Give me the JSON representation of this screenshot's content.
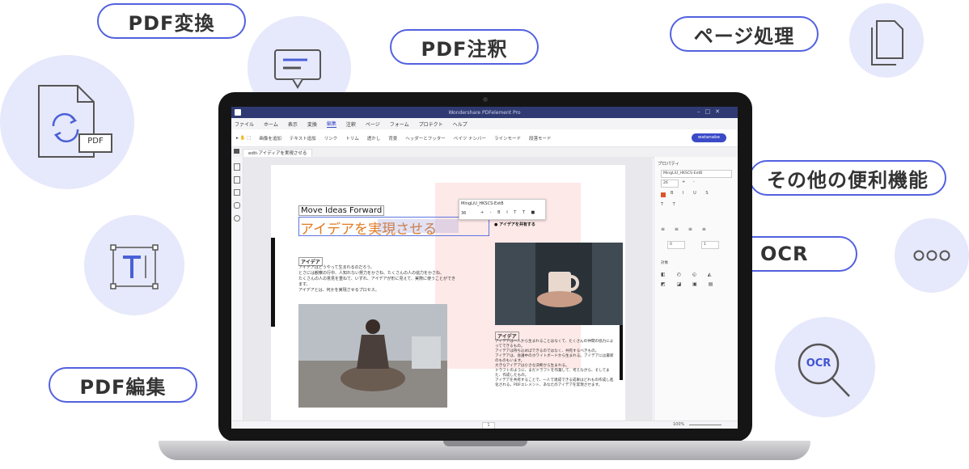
{
  "features": {
    "pdf_convert": "PDF変換",
    "pdf_annotate": "PDF注釈",
    "page_process": "ページ処理",
    "other_features": "その他の便利機能",
    "ocr": "OCR",
    "pdf_edit": "PDF編集",
    "ocr_icon_text": "OCR",
    "pdf_file_label": "PDF"
  },
  "app": {
    "title": "Wondershare PDFelement Pro",
    "menu": [
      "ファイル",
      "ホーム",
      "表示",
      "変換",
      "編集",
      "注釈",
      "ページ",
      "フォーム",
      "プロテクト",
      "ヘルプ"
    ],
    "active_menu_index": 4,
    "toolbar": [
      "画像を追加",
      "テキスト追加",
      "リンク",
      "トリム",
      "透かし",
      "背景",
      "ヘッダーとフッター",
      "ベイツ ナンバー",
      "ラインモード",
      "段落モード"
    ],
    "user": "watanabe",
    "tab": "edit-アイディアを実現させる",
    "page_number": "1",
    "zoom": "100%"
  },
  "document": {
    "heading_small": "Move Ideas Forward",
    "heading_large": "アイデアを実現させる",
    "font_name": "MingLiU_HKSCS-ExtB",
    "font_size": "36",
    "share_label": "アイデアを共有する",
    "section_title": "アイデア",
    "para1": "アイデアはどうやって生まれるのだろう。",
    "para2": "とさには観察の行中、人知れない努力をかさね、たくさんの人の協力をかさね、",
    "para3": "たくさんの人の意見を重ねて、いずれ、アイデアが形に見えて、実際に使うことができます。",
    "para4": "アイデアとは、何かを実現させるプロセス。",
    "right_title": "アイデア",
    "right_p1": "アイデアは一人から生まれることはなくて、たくさんの仲間の協力によってできるもの。",
    "right_p2": "アイデアは持ち込めばできるのではなく、共有するべきもの。",
    "right_p3": "アイデアは、会議中のホワイトボードから生まれる。アイデアには最新のものもいます。",
    "right_p4": "大きなアイデアは小さな決断から生まれる。",
    "right_p5": "ドラフトのように、まだドラフトを作業して、考えながら、そしてまた、作成したもの。",
    "right_p6": "アイデアを共有することで、一人で達成できる成果はどれもの作成し進化される。PDFエレメント、あなたのアイデアを実現させます。"
  },
  "properties": {
    "title": "プロパティ",
    "font": "MingLiU_HKSCS-ExtB",
    "size": "26",
    "spacing_a": "0",
    "spacing_b": "1",
    "object_label": "対象"
  },
  "colors": {
    "accent": "#5261e0",
    "circle_bg": "#e6e8fb",
    "titlebar": "#2f3a72",
    "heading_orange": "#e07a1f"
  }
}
